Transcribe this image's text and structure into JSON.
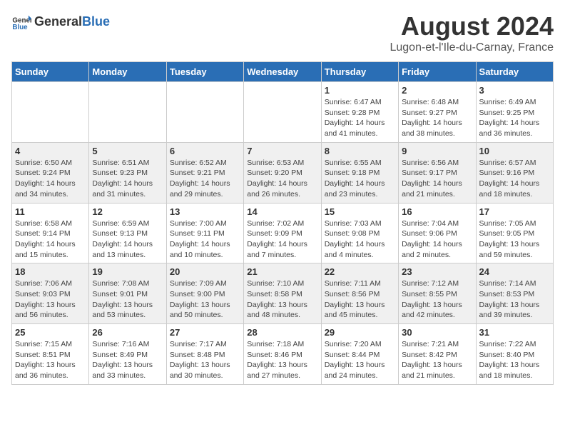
{
  "logo": {
    "text_general": "General",
    "text_blue": "Blue"
  },
  "title": "August 2024",
  "subtitle": "Lugon-et-l'Ile-du-Carnay, France",
  "days_of_week": [
    "Sunday",
    "Monday",
    "Tuesday",
    "Wednesday",
    "Thursday",
    "Friday",
    "Saturday"
  ],
  "weeks": [
    [
      {
        "day": "",
        "info": ""
      },
      {
        "day": "",
        "info": ""
      },
      {
        "day": "",
        "info": ""
      },
      {
        "day": "",
        "info": ""
      },
      {
        "day": "1",
        "info": "Sunrise: 6:47 AM\nSunset: 9:28 PM\nDaylight: 14 hours and 41 minutes."
      },
      {
        "day": "2",
        "info": "Sunrise: 6:48 AM\nSunset: 9:27 PM\nDaylight: 14 hours and 38 minutes."
      },
      {
        "day": "3",
        "info": "Sunrise: 6:49 AM\nSunset: 9:25 PM\nDaylight: 14 hours and 36 minutes."
      }
    ],
    [
      {
        "day": "4",
        "info": "Sunrise: 6:50 AM\nSunset: 9:24 PM\nDaylight: 14 hours and 34 minutes."
      },
      {
        "day": "5",
        "info": "Sunrise: 6:51 AM\nSunset: 9:23 PM\nDaylight: 14 hours and 31 minutes."
      },
      {
        "day": "6",
        "info": "Sunrise: 6:52 AM\nSunset: 9:21 PM\nDaylight: 14 hours and 29 minutes."
      },
      {
        "day": "7",
        "info": "Sunrise: 6:53 AM\nSunset: 9:20 PM\nDaylight: 14 hours and 26 minutes."
      },
      {
        "day": "8",
        "info": "Sunrise: 6:55 AM\nSunset: 9:18 PM\nDaylight: 14 hours and 23 minutes."
      },
      {
        "day": "9",
        "info": "Sunrise: 6:56 AM\nSunset: 9:17 PM\nDaylight: 14 hours and 21 minutes."
      },
      {
        "day": "10",
        "info": "Sunrise: 6:57 AM\nSunset: 9:16 PM\nDaylight: 14 hours and 18 minutes."
      }
    ],
    [
      {
        "day": "11",
        "info": "Sunrise: 6:58 AM\nSunset: 9:14 PM\nDaylight: 14 hours and 15 minutes."
      },
      {
        "day": "12",
        "info": "Sunrise: 6:59 AM\nSunset: 9:13 PM\nDaylight: 14 hours and 13 minutes."
      },
      {
        "day": "13",
        "info": "Sunrise: 7:00 AM\nSunset: 9:11 PM\nDaylight: 14 hours and 10 minutes."
      },
      {
        "day": "14",
        "info": "Sunrise: 7:02 AM\nSunset: 9:09 PM\nDaylight: 14 hours and 7 minutes."
      },
      {
        "day": "15",
        "info": "Sunrise: 7:03 AM\nSunset: 9:08 PM\nDaylight: 14 hours and 4 minutes."
      },
      {
        "day": "16",
        "info": "Sunrise: 7:04 AM\nSunset: 9:06 PM\nDaylight: 14 hours and 2 minutes."
      },
      {
        "day": "17",
        "info": "Sunrise: 7:05 AM\nSunset: 9:05 PM\nDaylight: 13 hours and 59 minutes."
      }
    ],
    [
      {
        "day": "18",
        "info": "Sunrise: 7:06 AM\nSunset: 9:03 PM\nDaylight: 13 hours and 56 minutes."
      },
      {
        "day": "19",
        "info": "Sunrise: 7:08 AM\nSunset: 9:01 PM\nDaylight: 13 hours and 53 minutes."
      },
      {
        "day": "20",
        "info": "Sunrise: 7:09 AM\nSunset: 9:00 PM\nDaylight: 13 hours and 50 minutes."
      },
      {
        "day": "21",
        "info": "Sunrise: 7:10 AM\nSunset: 8:58 PM\nDaylight: 13 hours and 48 minutes."
      },
      {
        "day": "22",
        "info": "Sunrise: 7:11 AM\nSunset: 8:56 PM\nDaylight: 13 hours and 45 minutes."
      },
      {
        "day": "23",
        "info": "Sunrise: 7:12 AM\nSunset: 8:55 PM\nDaylight: 13 hours and 42 minutes."
      },
      {
        "day": "24",
        "info": "Sunrise: 7:14 AM\nSunset: 8:53 PM\nDaylight: 13 hours and 39 minutes."
      }
    ],
    [
      {
        "day": "25",
        "info": "Sunrise: 7:15 AM\nSunset: 8:51 PM\nDaylight: 13 hours and 36 minutes."
      },
      {
        "day": "26",
        "info": "Sunrise: 7:16 AM\nSunset: 8:49 PM\nDaylight: 13 hours and 33 minutes."
      },
      {
        "day": "27",
        "info": "Sunrise: 7:17 AM\nSunset: 8:48 PM\nDaylight: 13 hours and 30 minutes."
      },
      {
        "day": "28",
        "info": "Sunrise: 7:18 AM\nSunset: 8:46 PM\nDaylight: 13 hours and 27 minutes."
      },
      {
        "day": "29",
        "info": "Sunrise: 7:20 AM\nSunset: 8:44 PM\nDaylight: 13 hours and 24 minutes."
      },
      {
        "day": "30",
        "info": "Sunrise: 7:21 AM\nSunset: 8:42 PM\nDaylight: 13 hours and 21 minutes."
      },
      {
        "day": "31",
        "info": "Sunrise: 7:22 AM\nSunset: 8:40 PM\nDaylight: 13 hours and 18 minutes."
      }
    ]
  ]
}
